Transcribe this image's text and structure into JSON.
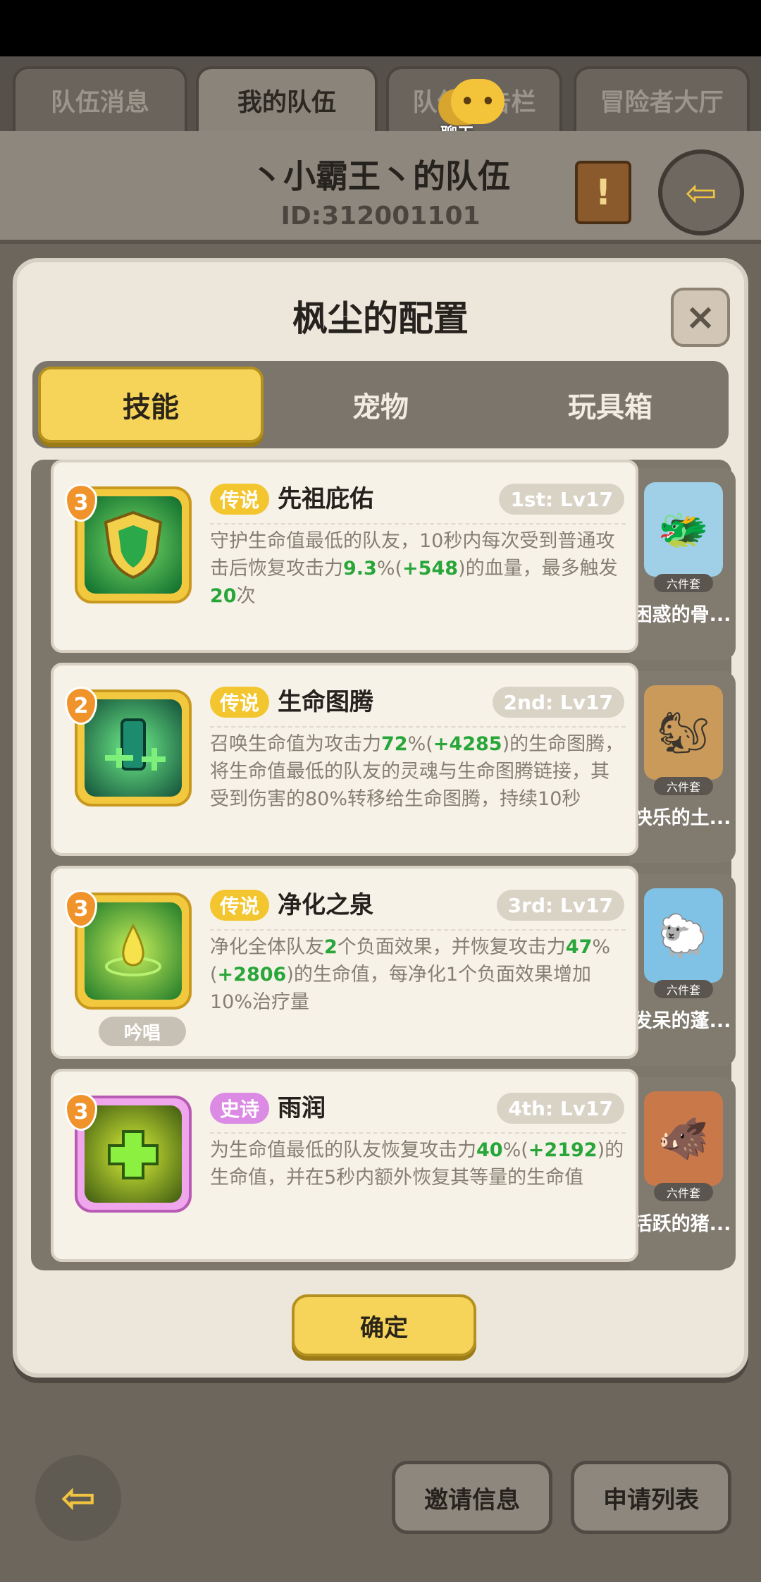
{
  "top_tabs": [
    "队伍消息",
    "我的队伍",
    "队伍公告栏",
    "冒险者大厅"
  ],
  "chat": {
    "label": "聊天",
    "icon": "chat-face-icon"
  },
  "team": {
    "name": "丶小霸王丶的队伍",
    "id": "ID:312001101"
  },
  "panel": {
    "title": "枫尘的配置",
    "close_label": "×",
    "tabs": [
      "技能",
      "宠物",
      "玩具箱"
    ],
    "active_tab": "技能"
  },
  "skills": [
    {
      "level": "3",
      "rarity": "传说",
      "name": "先祖庇佑",
      "slot": "1st: Lv17",
      "desc": [
        {
          "t": "守护生命值最低的队友，10秒内每次受到普通攻击后恢复攻击力"
        },
        {
          "t": "9.3",
          "n": true
        },
        {
          "t": "%("
        },
        {
          "t": "+548",
          "n": true
        },
        {
          "t": ")的血量，最多触发"
        },
        {
          "t": "20",
          "n": true
        },
        {
          "t": "次"
        }
      ]
    },
    {
      "level": "2",
      "rarity": "传说",
      "name": "生命图腾",
      "slot": "2nd: Lv17",
      "desc": [
        {
          "t": "召唤生命值为攻击力"
        },
        {
          "t": "72",
          "n": true
        },
        {
          "t": "%("
        },
        {
          "t": "+4285",
          "n": true
        },
        {
          "t": ")的生命图腾，将生命值最低的队友的灵魂与生命图腾链接，其受到伤害的80%转移给生命图腾，持续10秒"
        }
      ]
    },
    {
      "level": "3",
      "rarity": "传说",
      "name": "净化之泉",
      "slot": "3rd: Lv17",
      "tag": "吟唱",
      "desc": [
        {
          "t": "净化全体队友"
        },
        {
          "t": "2",
          "n": true
        },
        {
          "t": "个负面效果，并恢复攻击力"
        },
        {
          "t": "47",
          "n": true
        },
        {
          "t": "%("
        },
        {
          "t": "+2806",
          "n": true
        },
        {
          "t": ")的生命值，每净化1个负面效果增加10%治疗量"
        }
      ]
    },
    {
      "level": "3",
      "rarity": "史诗",
      "name": "雨润",
      "slot": "4th: Lv17",
      "desc": [
        {
          "t": "为生命值最低的队友恢复攻击力"
        },
        {
          "t": "40",
          "n": true
        },
        {
          "t": "%("
        },
        {
          "t": "+2192",
          "n": true
        },
        {
          "t": ")的生命值，并在5秒内额外恢复其等量的生命值"
        }
      ]
    }
  ],
  "pets": [
    {
      "name": "困惑的骨...",
      "set": "六件套"
    },
    {
      "name": "快乐的土...",
      "set": "六件套"
    },
    {
      "name": "发呆的蓬...",
      "set": "六件套"
    },
    {
      "name": "活跃的猪...",
      "set": "六件套"
    }
  ],
  "confirm_label": "确定",
  "bottom": {
    "invite_label": "邀请信息",
    "apply_label": "申请列表",
    "back_icon": "back-arrow-icon"
  },
  "colors": {
    "accent_yellow": "#f6d45a",
    "green_number": "#29a63a",
    "legend_badge": "#f3c62f",
    "epic_badge": "#dc8be4"
  }
}
